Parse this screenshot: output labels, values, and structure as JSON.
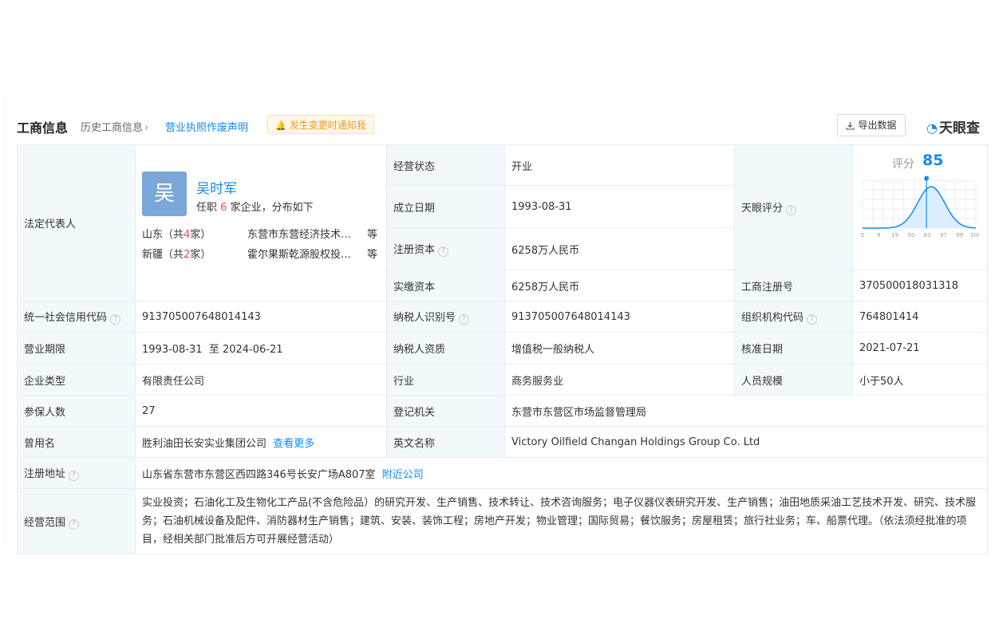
{
  "header": {
    "title": "工商信息",
    "history": "历史工商信息",
    "declare_link": "营业执照作废声明",
    "notice": "发生变更时通知我",
    "export": "导出数据",
    "logo": "天眼查"
  },
  "legal_rep": {
    "label": "法定代表人",
    "avatar_char": "吴",
    "name": "吴时军",
    "summary_pre": "任职",
    "summary_count": "6",
    "summary_post": "家企业，分布如下",
    "provinces": [
      {
        "name": "山东",
        "count": "4",
        "company": "东营市东营经济技术开发区",
        "etc": "等"
      },
      {
        "name": "新疆",
        "count": "2",
        "company": "霍尔果斯乾源股权投资有限公司",
        "etc": "等"
      }
    ]
  },
  "fields": {
    "status_label": "经营状态",
    "status_value": "开业",
    "established_label": "成立日期",
    "established_value": "1993-08-31",
    "reg_capital_label": "注册资本",
    "reg_capital_value": "6258万人民币",
    "paid_capital_label": "实缴资本",
    "paid_capital_value": "6258万人民币",
    "score_label": "天眼评分",
    "reg_no_label": "工商注册号",
    "reg_no_value": "370500018031318",
    "credit_code_label": "统一社会信用代码",
    "credit_code_value": "913705007648014143",
    "taxpayer_id_label": "纳税人识别号",
    "taxpayer_id_value": "913705007648014143",
    "org_code_label": "组织机构代码",
    "org_code_value": "764801414",
    "term_label": "营业期限",
    "term_value": "1993-08-31  至 2024-06-21",
    "tax_qual_label": "纳税人资质",
    "tax_qual_value": "增值税一般纳税人",
    "approval_label": "核准日期",
    "approval_value": "2021-07-21",
    "type_label": "企业类型",
    "type_value": "有限责任公司",
    "industry_label": "行业",
    "industry_value": "商务服务业",
    "staff_label": "人员规模",
    "staff_value": "小于50人",
    "insured_label": "参保人数",
    "insured_value": "27",
    "authority_label": "登记机关",
    "authority_value": "东营市东营区市场监督管理局",
    "former_label": "曾用名",
    "former_value": "胜利油田长安实业集团公司",
    "former_more": "查看更多",
    "english_label": "英文名称",
    "english_value": "Victory Oilfield Changan Holdings Group Co. Ltd",
    "address_label": "注册地址",
    "address_value": "山东省东营市东营区西四路346号长安广场A807室",
    "address_link": "附近公司",
    "scope_label": "经营范围",
    "scope_value": "实业投资；石油化工及生物化工产品(不含危险品）的研究开发、生产销售、技术转让、技术咨询服务；电子仪器仪表研究开发、生产销售；油田地质采油工艺技术开发、研究、技术服务；石油机械设备及配件、消防器材生产销售；建筑、安装、装饰工程；房地产开发；物业管理；国际贸易；餐饮服务；房屋租赁；旅行社业务；车、船票代理。（依法须经批准的项目，经相关部门批准后方可开展经营活动）"
  },
  "score": {
    "label": "评分",
    "value": 85,
    "x_ticks": [
      "5",
      "9",
      "19",
      "50",
      "83",
      "97",
      "99",
      "100"
    ],
    "marker_tick": "83"
  },
  "colors": {
    "accent": "#128bed",
    "label_bg": "#f2f9fc",
    "border": "#e4eef6",
    "notice": "#f19c1c",
    "count": "#fd485e"
  }
}
